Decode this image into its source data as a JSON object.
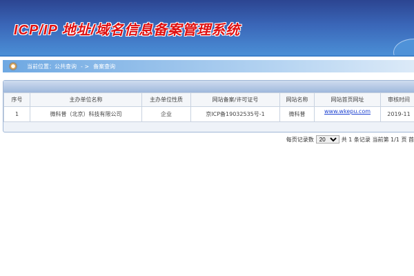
{
  "header": {
    "title": "ICP/IP 地址/域名信息备案管理系统"
  },
  "breadcrumb": {
    "label": "当前位置：",
    "items": [
      "公共查询",
      "- >",
      "备案查询"
    ]
  },
  "table": {
    "columns": [
      "序号",
      "主办单位名称",
      "主办单位性质",
      "网站备案/许可证号",
      "网站名称",
      "网站首页网址",
      "审核时间"
    ],
    "rows": [
      [
        "1",
        "微科普（北京）科技有限公司",
        "企业",
        "京ICP备19032535号-1",
        "微科普",
        "www.wkepu.com",
        "2019-11"
      ]
    ]
  },
  "pager": {
    "per_page_label": "每页记录数",
    "per_page": "20",
    "total": "共 1 条记录",
    "current": "当前第 1/1 页",
    "first": "首"
  },
  "colors": {
    "header": "#2c4591",
    "title": "#e01010",
    "link": "#1a3fd0"
  }
}
